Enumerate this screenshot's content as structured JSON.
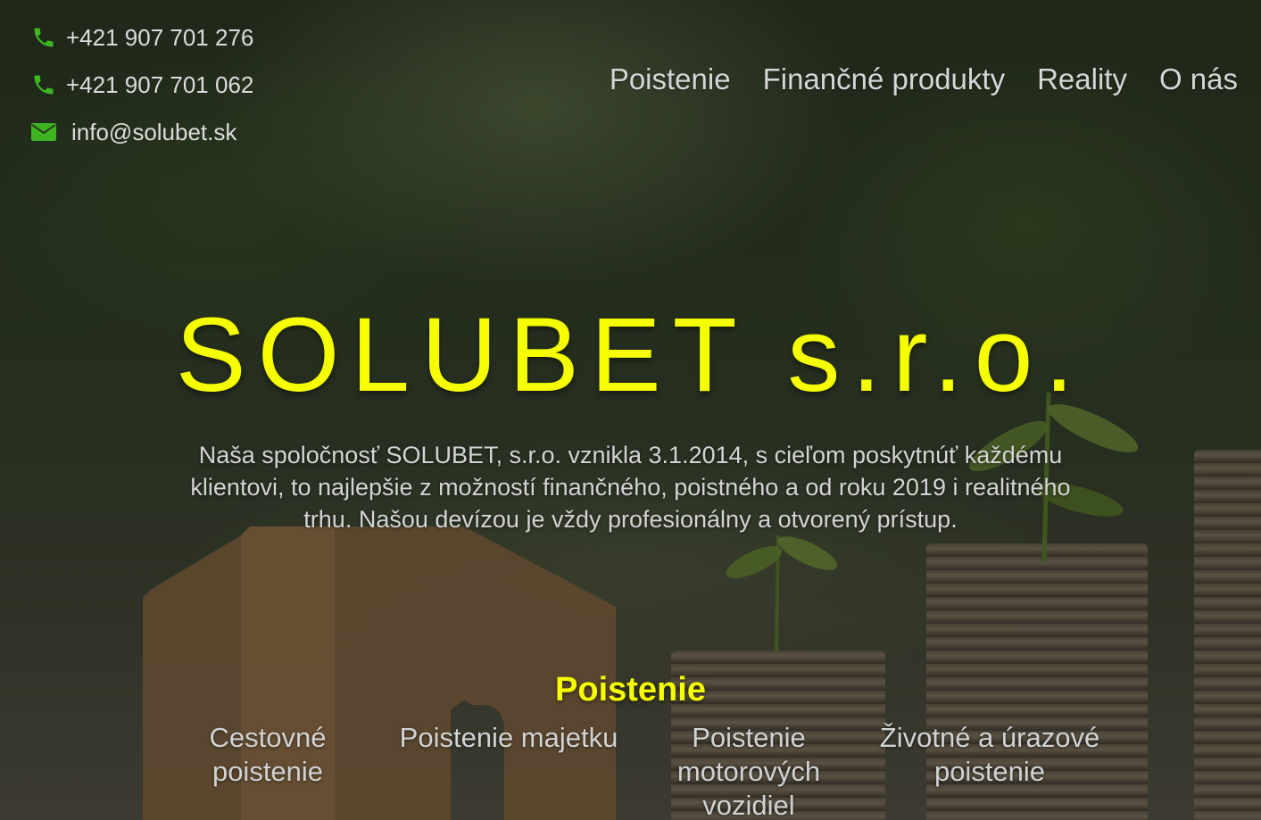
{
  "contacts": {
    "phone1": "+421 907 701 276",
    "phone2": "+421 907 701 062",
    "email": "info@solubet.sk",
    "phone_icon": "phone-icon",
    "email_icon": "envelope-icon",
    "icon_color": "#3cb521"
  },
  "nav": {
    "items": [
      {
        "label": "Poistenie"
      },
      {
        "label": "Finančné produkty"
      },
      {
        "label": "Reality"
      },
      {
        "label": "O nás"
      }
    ]
  },
  "hero": {
    "title": "SOLUBET s.r.o.",
    "description": "Naša spoločnosť SOLUBET, s.r.o. vznikla 3.1.2014, s cieľom poskytnúť každému klientovi, to najlepšie z možností finančného, poistného a od roku 2019 i realitného trhu. Našou devízou je vždy profesionálny a otvorený prístup.",
    "accent_color": "#f5ff00"
  },
  "insurance": {
    "title": "Poistenie",
    "items": [
      {
        "label": "Cestovné poistenie"
      },
      {
        "label": "Poistenie majetku"
      },
      {
        "label": "Poistenie motorových vozidiel"
      },
      {
        "label": "Životné a úrazové poistenie"
      }
    ]
  }
}
